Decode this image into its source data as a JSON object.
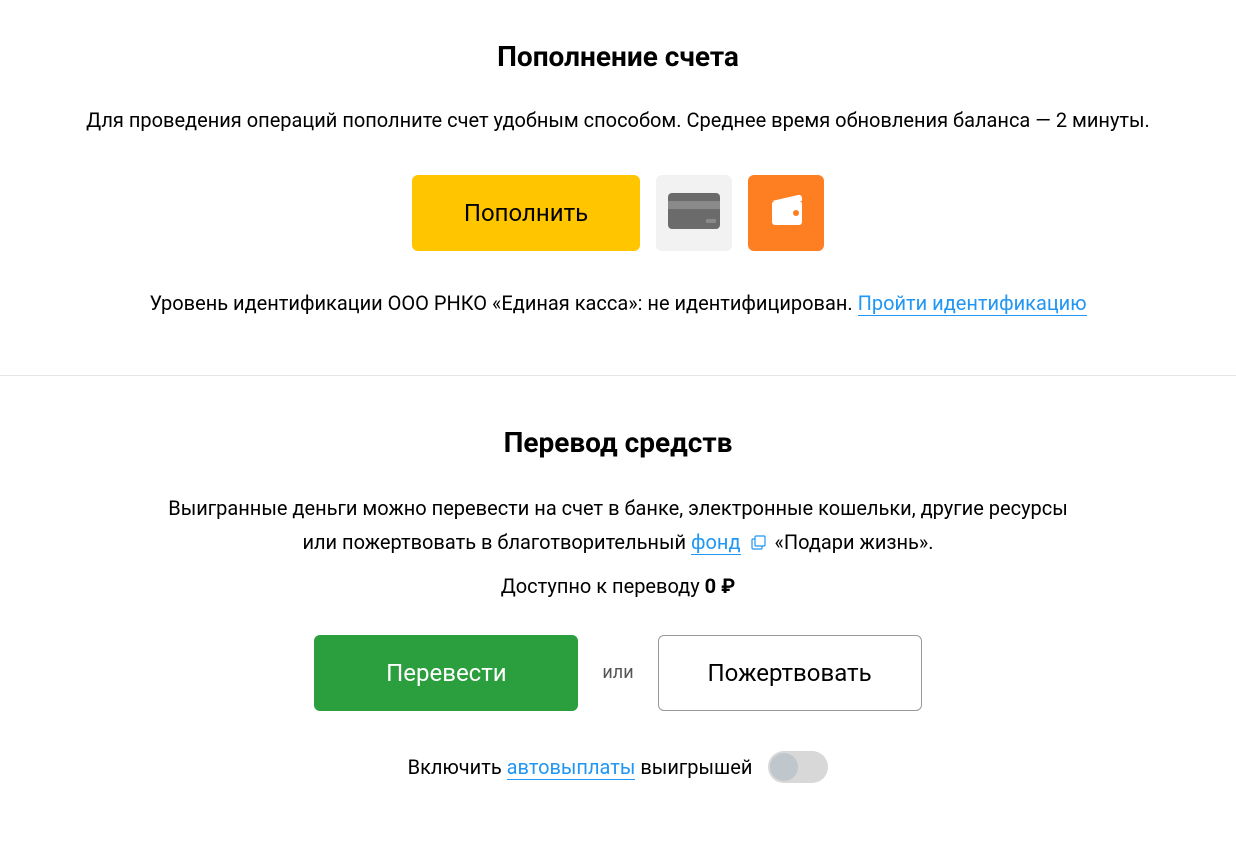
{
  "deposit": {
    "title": "Пополнение счета",
    "description": "Для проведения операций пополните счет удобным способом. Среднее время обновления баланса — 2 минуты.",
    "button_label": "Пополнить",
    "identification_prefix": "Уровень идентификации ООО РНКО «Единая касса»: не идентифицирован. ",
    "identification_link": "Пройти идентификацию"
  },
  "transfer": {
    "title": "Перевод средств",
    "desc_line1": "Выигранные деньги можно перевести на счет в банке, электронные кошельки, другие ресурсы",
    "desc_line2_prefix": "или пожертвовать в благотворительный ",
    "fund_link": "фонд",
    "desc_line2_suffix": " «Подари жизнь».",
    "available_prefix": "Доступно к переводу ",
    "available_amount": "0",
    "available_currency": " ₽",
    "transfer_button": "Перевести",
    "or_label": "или",
    "donate_button": "Пожертвовать",
    "autopay_prefix": "Включить ",
    "autopay_link": "автовыплаты",
    "autopay_suffix": " выигрышей"
  }
}
